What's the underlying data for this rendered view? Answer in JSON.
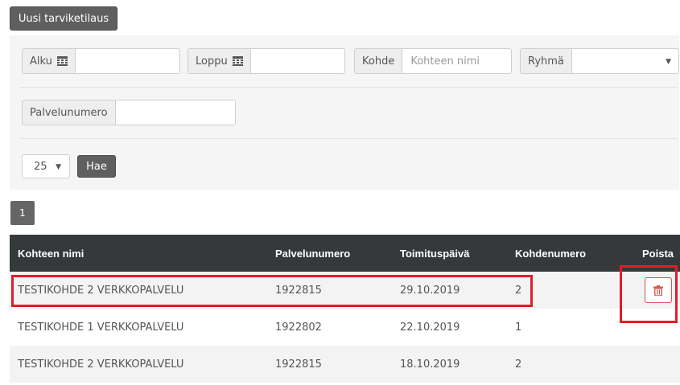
{
  "toolbar": {
    "new_order_label": "Uusi tarviketilaus"
  },
  "filters": {
    "start_label": "Alku",
    "start_value": "",
    "end_label": "Loppu",
    "end_value": "",
    "target_label": "Kohde",
    "target_placeholder": "Kohteen nimi",
    "group_label": "Ryhmä",
    "group_value": "",
    "service_number_label": "Palvelunumero",
    "service_number_value": "",
    "page_size_value": "25",
    "search_label": "Hae"
  },
  "pagination": {
    "current_page": "1"
  },
  "table": {
    "columns": [
      "Kohteen nimi",
      "Palvelunumero",
      "Toimituspäivä",
      "Kohdenumero",
      "Poista"
    ],
    "rows": [
      {
        "name": "TESTIKOHDE 2 VERKKOPALVELU",
        "service_number": "1922815",
        "delivery_date": "29.10.2019",
        "target_number": "2",
        "deletable": true
      },
      {
        "name": "TESTIKOHDE 1 VERKKOPALVELU",
        "service_number": "1922802",
        "delivery_date": "22.10.2019",
        "target_number": "1",
        "deletable": false
      },
      {
        "name": "TESTIKOHDE 2 VERKKOPALVELU",
        "service_number": "1922815",
        "delivery_date": "18.10.2019",
        "target_number": "2",
        "deletable": false
      }
    ]
  },
  "icons": {
    "calendar": "calendar-icon",
    "trash": "trash-icon",
    "caret": "caret-down-icon"
  },
  "colors": {
    "header_bg": "#35393c",
    "button_dark": "#5f5f5f",
    "danger": "#d9534f",
    "highlight": "#e11d2a"
  }
}
